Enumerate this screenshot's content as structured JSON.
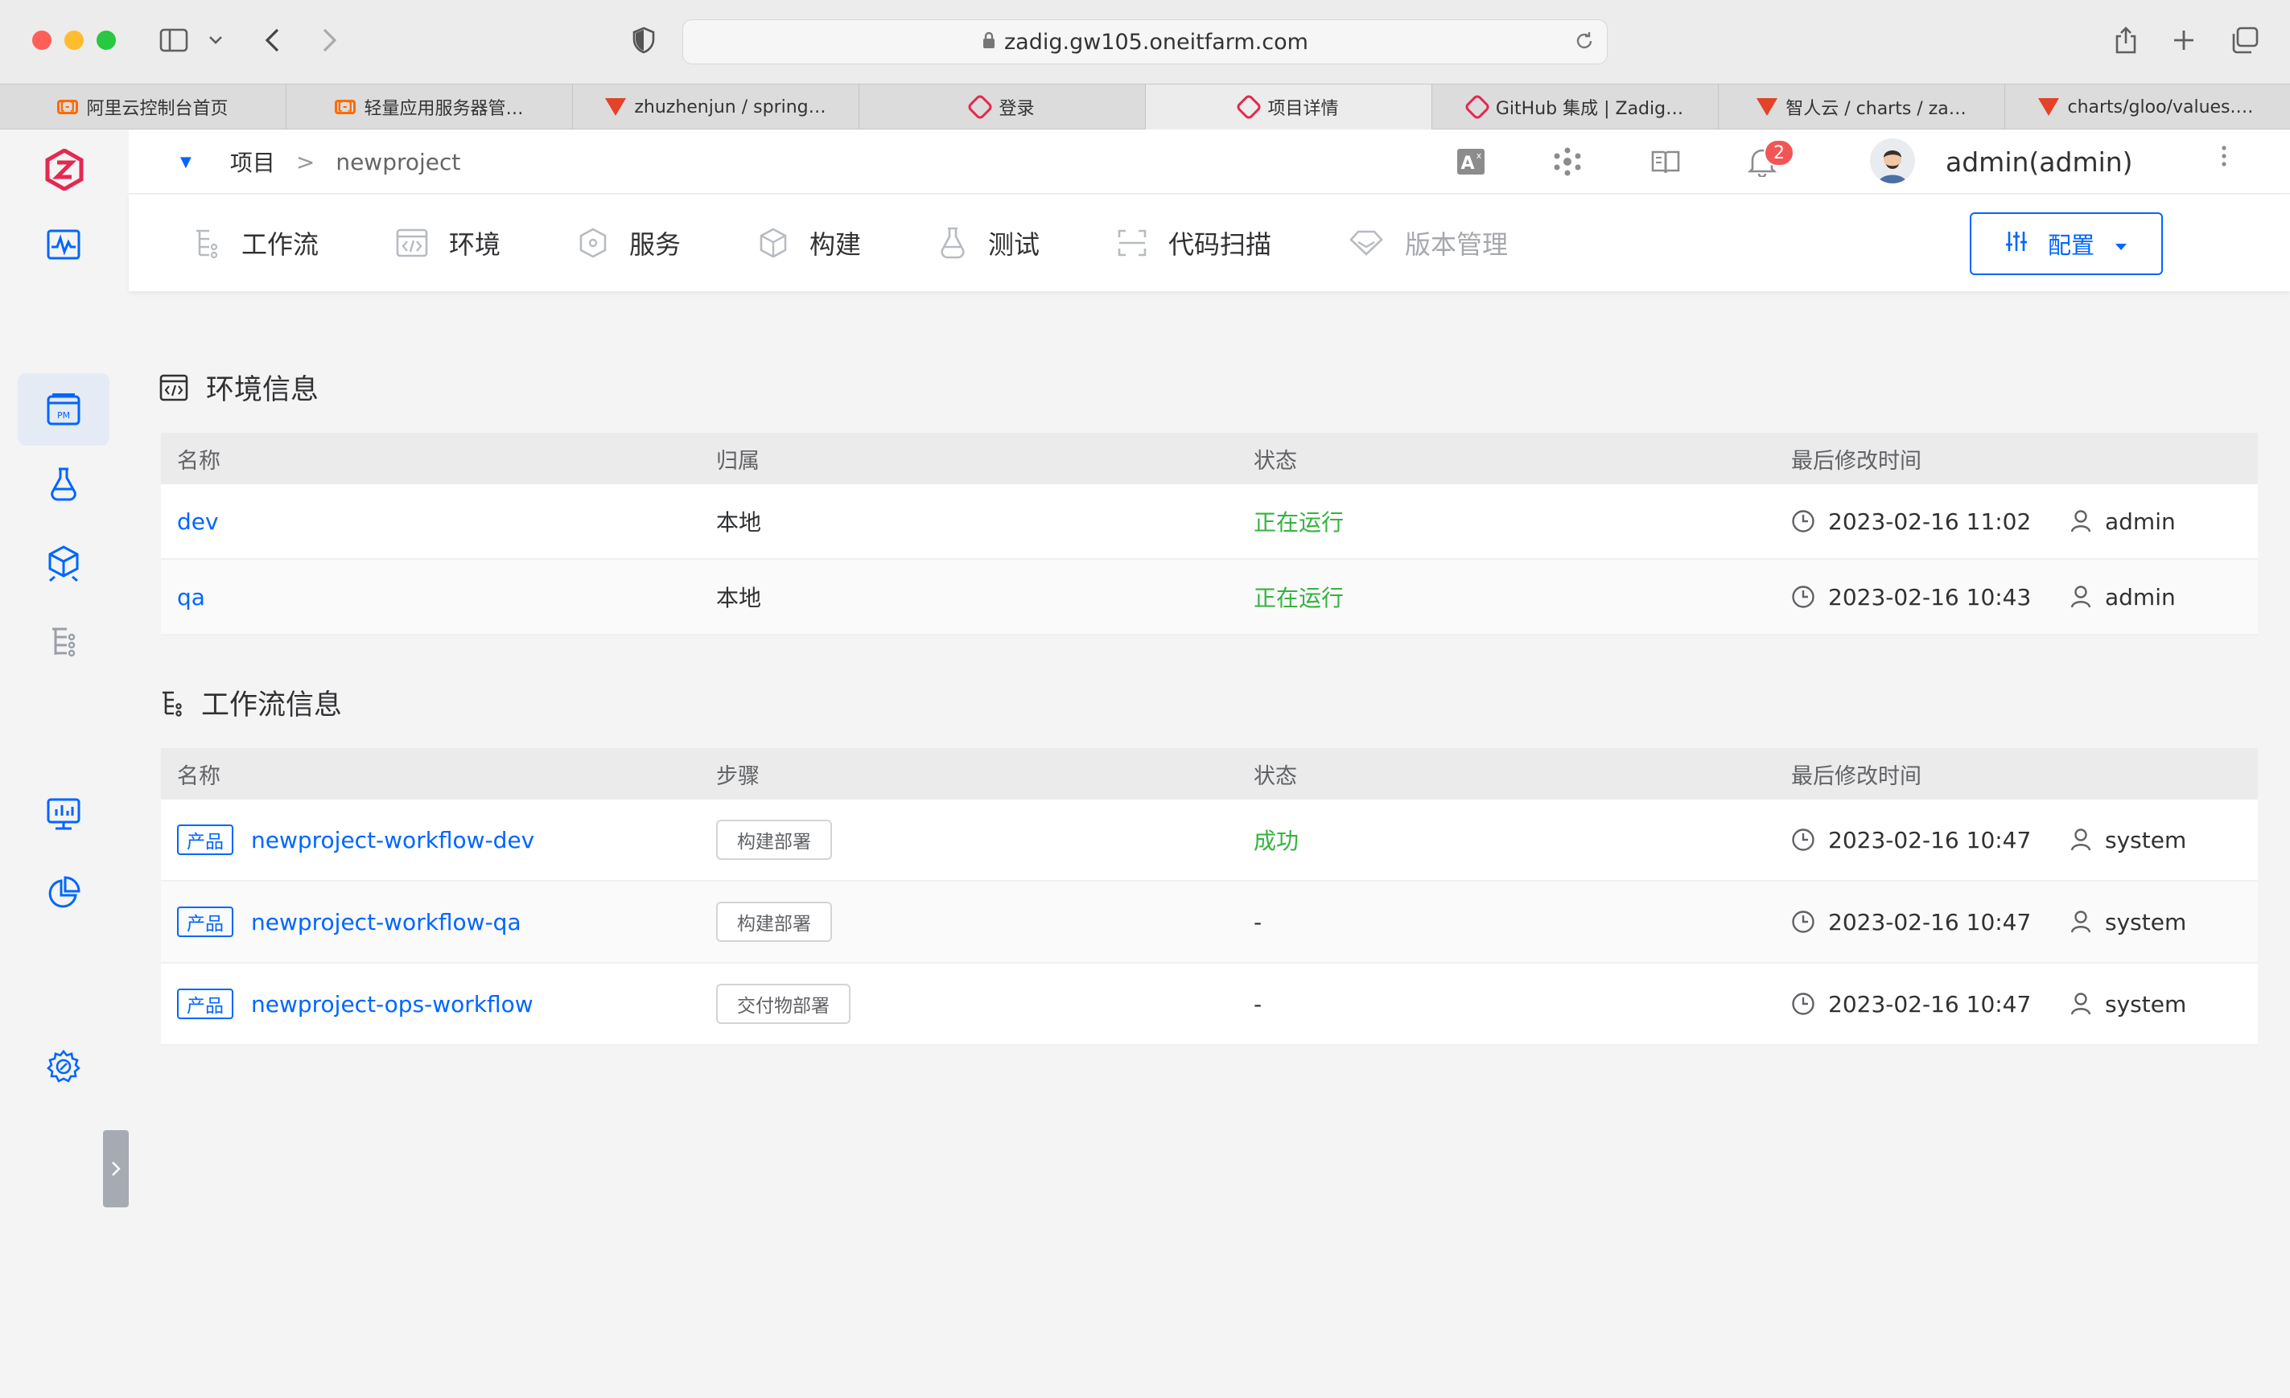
{
  "browser": {
    "url": "zadig.gw105.oneitfarm.com",
    "tabs": [
      {
        "title": "阿里云控制台首页",
        "favicon": "aliyun-icon"
      },
      {
        "title": "轻量应用服务器管…",
        "favicon": "aliyun-icon"
      },
      {
        "title": "zhuzhenjun / spring…",
        "favicon": "gitlab-icon"
      },
      {
        "title": "登录",
        "favicon": "zadig-icon"
      },
      {
        "title": "项目详情",
        "favicon": "zadig-icon",
        "active": true
      },
      {
        "title": "GitHub 集成 | Zadig…",
        "favicon": "zadig-icon"
      },
      {
        "title": "智人云 / charts / za…",
        "favicon": "gitlab-icon"
      },
      {
        "title": "charts/gloo/values.…",
        "favicon": "gitlab-icon"
      }
    ]
  },
  "header": {
    "breadcrumb_root": "项目",
    "breadcrumb_sep": ">",
    "breadcrumb_current": "newproject",
    "notification_count": "2",
    "user": "admin(admin)"
  },
  "nav": {
    "items": [
      "工作流",
      "环境",
      "服务",
      "构建",
      "测试",
      "代码扫描",
      "版本管理"
    ],
    "config_label": "配置"
  },
  "env_section": {
    "title": "环境信息",
    "columns": [
      "名称",
      "归属",
      "状态",
      "最后修改时间"
    ],
    "rows": [
      {
        "name": "dev",
        "owner": "本地",
        "status": "正在运行",
        "time": "2023-02-16 11:02",
        "user": "admin"
      },
      {
        "name": "qa",
        "owner": "本地",
        "status": "正在运行",
        "time": "2023-02-16 10:43",
        "user": "admin"
      }
    ]
  },
  "workflow_section": {
    "title": "工作流信息",
    "columns": [
      "名称",
      "步骤",
      "状态",
      "最后修改时间"
    ],
    "rows": [
      {
        "tag": "产品",
        "name": "newproject-workflow-dev",
        "step": "构建部署",
        "status": "成功",
        "time": "2023-02-16 10:47",
        "user": "system"
      },
      {
        "tag": "产品",
        "name": "newproject-workflow-qa",
        "step": "构建部署",
        "status": "-",
        "time": "2023-02-16 10:47",
        "user": "system"
      },
      {
        "tag": "产品",
        "name": "newproject-ops-workflow",
        "step": "交付物部署",
        "status": "-",
        "time": "2023-02-16 10:47",
        "user": "system"
      }
    ]
  },
  "colors": {
    "accent": "#0066ff",
    "success": "#33b43e",
    "brand": "#e5284f",
    "badge": "#f25555"
  }
}
